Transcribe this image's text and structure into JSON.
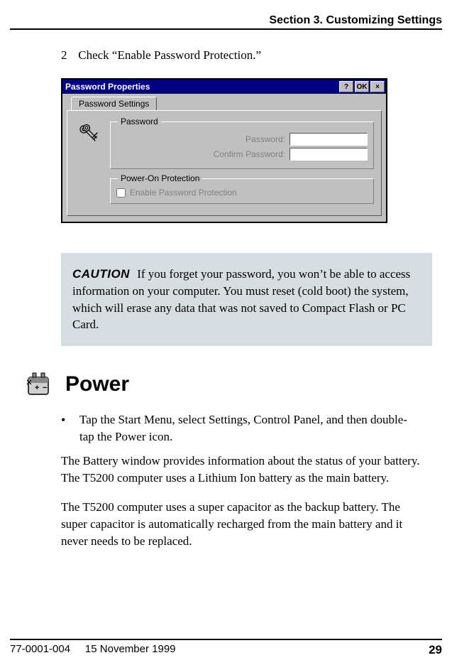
{
  "header": {
    "section": "Section 3. Customizing Settings"
  },
  "step": {
    "num": "2",
    "text": "Check “Enable Password Protection.”"
  },
  "dialog": {
    "title": "Password Properties",
    "btn_help": "?",
    "btn_ok": "OK",
    "btn_close": "×",
    "tab": "Password Settings",
    "group_password": "Password",
    "label_password": "Password:",
    "label_confirm": "Confirm Password:",
    "group_poweron": "Power-On Protection",
    "checkbox_label": "Enable Password Protection"
  },
  "caution": {
    "label": "CAUTION",
    "text": "If you forget your password, you won’t be able to access information on your computer. You must reset (cold boot) the system, which will erase any data that was not saved to Compact Flash or PC Card."
  },
  "power": {
    "heading": "Power",
    "bullet": "Tap the Start Menu, select Settings, Control Panel, and then double-tap the Power icon.",
    "para1": "The Battery window provides information about the status of your battery. The T5200 computer uses a Lithium Ion battery as the main battery.",
    "para2": "The T5200 computer uses a super capacitor as the backup battery. The super capacitor is automatically recharged from the main battery and it never needs to be replaced."
  },
  "footer": {
    "docnum": "77-0001-004",
    "date": "15 November 1999",
    "page": "29"
  }
}
